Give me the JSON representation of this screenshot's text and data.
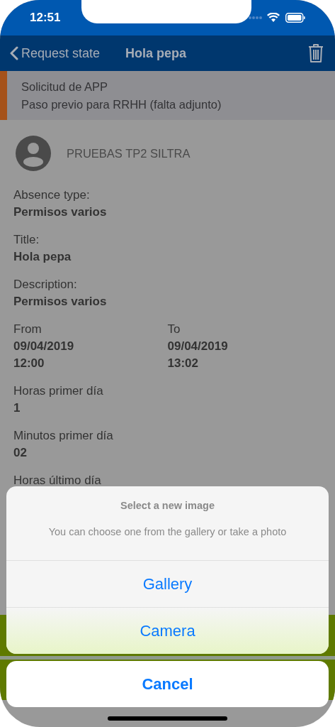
{
  "status_bar": {
    "time": "12:51"
  },
  "nav": {
    "back_label": "Request state",
    "title": "Hola pepa"
  },
  "banner": {
    "color": "#a5521a",
    "lines": [
      "Solicitud de APP",
      "Paso previo para RRHH (falta adjunto)"
    ]
  },
  "user": {
    "name": "PRUEBAS TP2 SILTRA"
  },
  "fields": [
    {
      "kind": "single",
      "label": "Absence type:",
      "values": [
        "Permisos varios"
      ]
    },
    {
      "kind": "single",
      "label": "Title:",
      "values": [
        "Hola pepa"
      ]
    },
    {
      "kind": "single",
      "label": "Description:",
      "values": [
        "Permisos varios"
      ]
    },
    {
      "kind": "pair",
      "columns": [
        {
          "label": "From",
          "values": [
            "09/04/2019",
            "12:00"
          ]
        },
        {
          "label": "To",
          "values": [
            "09/04/2019",
            "13:02"
          ]
        }
      ]
    },
    {
      "kind": "single",
      "label": "Horas primer día",
      "values": [
        "1"
      ]
    },
    {
      "kind": "single",
      "label": "Minutos primer día",
      "values": [
        "02"
      ]
    },
    {
      "kind": "single",
      "label": "Horas último día"
    }
  ],
  "action_sheet": {
    "title": "Select a new image",
    "message": "You can choose one from the gallery or take a photo",
    "actions": [
      "Gallery",
      "Camera"
    ],
    "cancel": "Cancel"
  }
}
